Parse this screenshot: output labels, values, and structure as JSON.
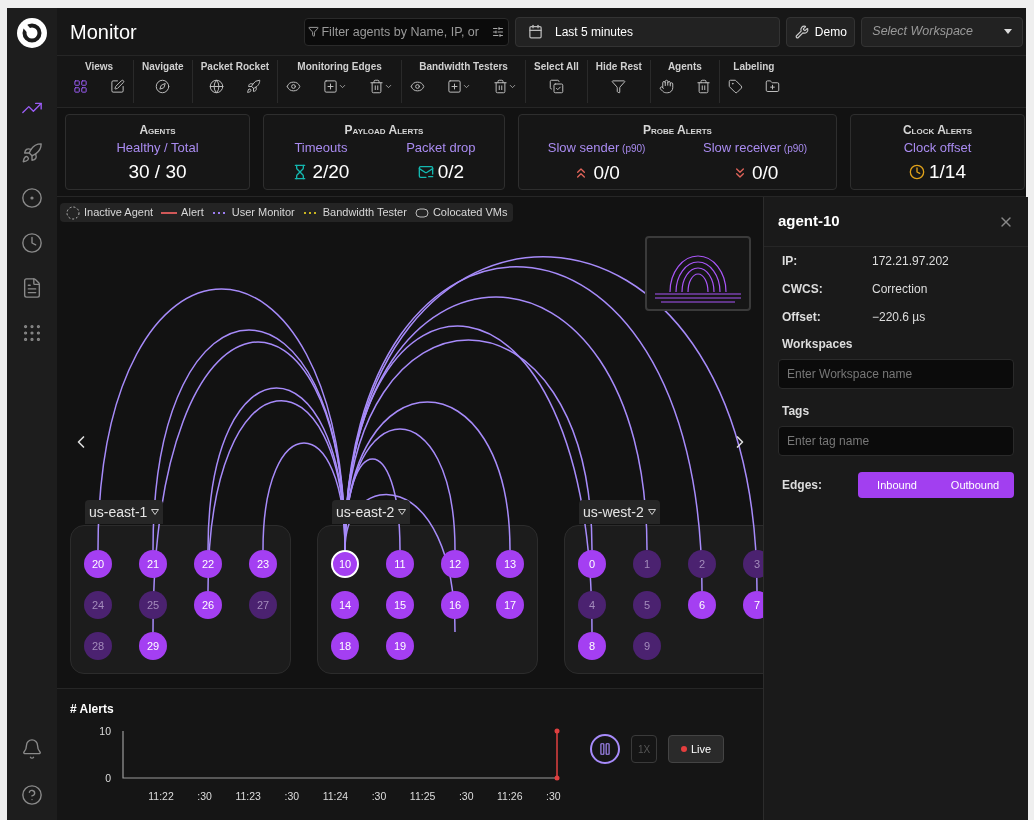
{
  "app": {
    "title": "Monitor"
  },
  "sidebar": {
    "items": [
      {
        "selected": true
      },
      {
        "selected": false
      },
      {
        "selected": false
      },
      {
        "selected": false
      },
      {
        "selected": false
      },
      {
        "selected": false
      }
    ]
  },
  "header": {
    "filter": {
      "placeholder": "Filter agents by Name, IP, or"
    },
    "time_range": "Last 5 minutes",
    "demo_button": "Demo",
    "workspace_select": {
      "placeholder": "Select Workspace"
    }
  },
  "toolbar": [
    {
      "label": "Views",
      "tools": [
        {
          "selected": true
        },
        {
          "selected": false
        }
      ]
    },
    {
      "label": "Navigate"
    },
    {
      "label": "Packet Rocket"
    },
    {
      "label": "Monitoring Edges"
    },
    {
      "label": "Bandwidth Testers"
    },
    {
      "label": "Select All"
    },
    {
      "label": "Hide Rest"
    },
    {
      "label": "Agents"
    },
    {
      "label": "Labeling"
    }
  ],
  "stat_cards": [
    {
      "title": "Agents",
      "metrics": [
        {
          "label": "Healthy / Total",
          "value": "30 / 30"
        }
      ]
    },
    {
      "title": "Payload Alerts",
      "metrics": [
        {
          "label": "Timeouts",
          "value": "2/20",
          "color": "#14b8b0"
        },
        {
          "label": "Packet drop",
          "value": "0/2",
          "color": "#14b8b0"
        }
      ]
    },
    {
      "title": "Probe Alerts",
      "metrics": [
        {
          "label": "Slow sender",
          "qualifier": "(p90)",
          "value": "0/0",
          "color": "#e0645a"
        },
        {
          "label": "Slow receiver",
          "qualifier": "(p90)",
          "value": "0/0",
          "color": "#e0645a"
        }
      ]
    },
    {
      "title": "Clock Alerts",
      "metrics": [
        {
          "label": "Clock offset",
          "value": "1/14",
          "color": "#e0a21a"
        }
      ]
    }
  ],
  "legend": [
    {
      "kind": "inactive",
      "label": "Inactive Agent"
    },
    {
      "kind": "alert",
      "label": "Alert"
    },
    {
      "kind": "user_monitor",
      "label": "User Monitor"
    },
    {
      "kind": "bandwidth",
      "label": "Bandwidth Tester"
    },
    {
      "kind": "colocated",
      "label": "Colocated VMs"
    }
  ],
  "regions": [
    {
      "name": "us-east-1",
      "agents": [
        {
          "label": "20",
          "active": true,
          "selected": false
        },
        {
          "label": "21",
          "active": true,
          "selected": false
        },
        {
          "label": "22",
          "active": true,
          "selected": false
        },
        {
          "label": "23",
          "active": true,
          "selected": false
        },
        {
          "label": "24",
          "active": false,
          "selected": false
        },
        {
          "label": "25",
          "active": false,
          "selected": false
        },
        {
          "label": "26",
          "active": true,
          "selected": false
        },
        {
          "label": "27",
          "active": false,
          "selected": false
        },
        {
          "label": "28",
          "active": false,
          "selected": false
        },
        {
          "label": "29",
          "active": true,
          "selected": false
        }
      ]
    },
    {
      "name": "us-east-2",
      "agents": [
        {
          "label": "10",
          "active": true,
          "selected": true
        },
        {
          "label": "11",
          "active": true,
          "selected": false
        },
        {
          "label": "12",
          "active": true,
          "selected": false
        },
        {
          "label": "13",
          "active": true,
          "selected": false
        },
        {
          "label": "14",
          "active": true,
          "selected": false
        },
        {
          "label": "15",
          "active": true,
          "selected": false
        },
        {
          "label": "16",
          "active": true,
          "selected": false
        },
        {
          "label": "17",
          "active": true,
          "selected": false
        },
        {
          "label": "18",
          "active": true,
          "selected": false
        },
        {
          "label": "19",
          "active": true,
          "selected": false
        }
      ]
    },
    {
      "name": "us-west-2",
      "agents": [
        {
          "label": "0",
          "active": true,
          "selected": false
        },
        {
          "label": "1",
          "active": false,
          "selected": false
        },
        {
          "label": "2",
          "active": false,
          "selected": false
        },
        {
          "label": "3",
          "active": false,
          "selected": false
        },
        {
          "label": "4",
          "active": false,
          "selected": false
        },
        {
          "label": "5",
          "active": false,
          "selected": false
        },
        {
          "label": "6",
          "active": true,
          "selected": false
        },
        {
          "label": "7",
          "active": true,
          "selected": false
        },
        {
          "label": "8",
          "active": true,
          "selected": false
        },
        {
          "label": "9",
          "active": false,
          "selected": false
        }
      ]
    }
  ],
  "alerts": {
    "title": "# Alerts",
    "chart_data": {
      "type": "line",
      "ylim": [
        0,
        10
      ],
      "yticks": [
        0,
        10
      ],
      "categories": [
        "11:22",
        ":30",
        "11:23",
        ":30",
        "11:24",
        ":30",
        "11:25",
        ":30",
        "11:26",
        ":30"
      ]
    },
    "playback": {
      "paused": false,
      "speed": {
        "label": "1X",
        "disabled": true
      },
      "live_button": "Live"
    }
  },
  "details": {
    "title": "agent-10",
    "fields": [
      {
        "label": "IP:",
        "value": "172.21.97.202"
      },
      {
        "label": "CWCS:",
        "value": "Correction"
      },
      {
        "label": "Offset:",
        "value": "−220.6 µs"
      }
    ],
    "workspaces": {
      "label": "Workspaces",
      "placeholder": "Enter Workspace name"
    },
    "tags": {
      "label": "Tags",
      "placeholder": "Enter tag name"
    },
    "edges": {
      "label": "Edges:",
      "options": [
        {
          "label": "Inbound",
          "selected": true
        },
        {
          "label": "Outbound",
          "selected": true
        }
      ]
    }
  }
}
